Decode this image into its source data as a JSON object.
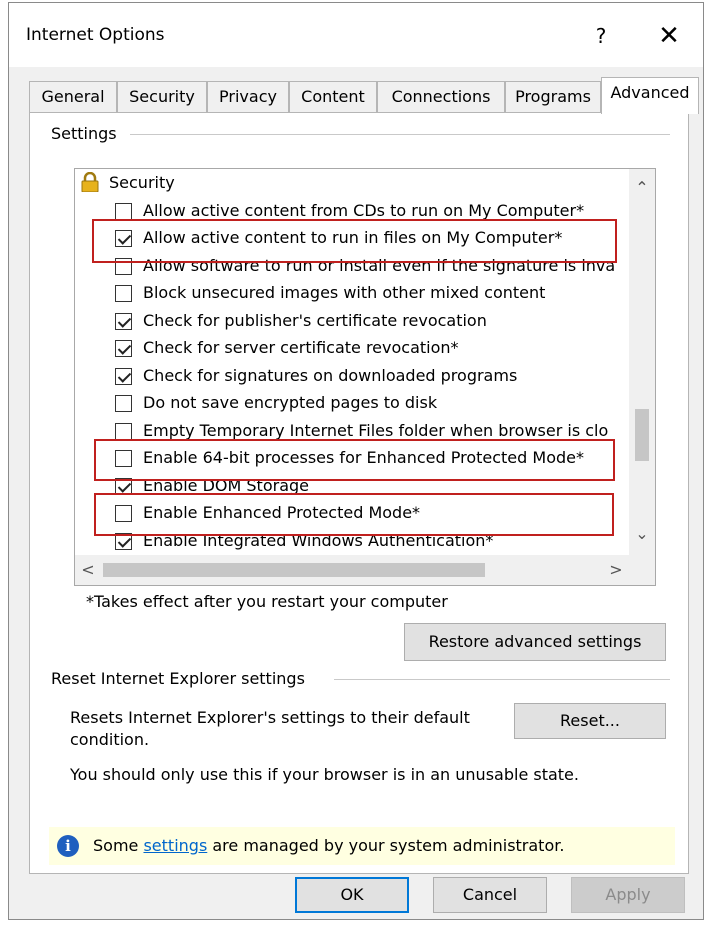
{
  "window": {
    "title": "Internet Options",
    "help_glyph": "?",
    "close_glyph": "✕"
  },
  "tabs": [
    "General",
    "Security",
    "Privacy",
    "Content",
    "Connections",
    "Programs",
    "Advanced"
  ],
  "active_tab": "Advanced",
  "settings": {
    "group_label": "Settings",
    "category": "Security",
    "items": [
      {
        "label": "Allow active content from CDs to run on My Computer*",
        "checked": false
      },
      {
        "label": "Allow active content to run in files on My Computer*",
        "checked": true
      },
      {
        "label": "Allow software to run or install even if the signature is inva",
        "checked": false
      },
      {
        "label": "Block unsecured images with other mixed content",
        "checked": false
      },
      {
        "label": "Check for publisher's certificate revocation",
        "checked": true
      },
      {
        "label": "Check for server certificate revocation*",
        "checked": true
      },
      {
        "label": "Check for signatures on downloaded programs",
        "checked": true
      },
      {
        "label": "Do not save encrypted pages to disk",
        "checked": false
      },
      {
        "label": "Empty Temporary Internet Files folder when browser is clo",
        "checked": false
      },
      {
        "label": "Enable 64-bit processes for Enhanced Protected Mode*",
        "checked": false
      },
      {
        "label": "Enable DOM Storage",
        "checked": true
      },
      {
        "label": "Enable Enhanced Protected Mode*",
        "checked": false
      },
      {
        "label": "Enable Integrated Windows Authentication*",
        "checked": true
      }
    ],
    "highlighted_items": [
      "Allow active content to run in files on My Computer*",
      "Enable 64-bit processes for Enhanced Protected Mode*",
      "Enable Enhanced Protected Mode*"
    ],
    "footnote": "*Takes effect after you restart your computer",
    "restore_button": "Restore advanced settings",
    "scroll_arrows": {
      "up": "⌃",
      "down": "⌄",
      "left": "<",
      "right": ">"
    }
  },
  "reset": {
    "group_label": "Reset Internet Explorer settings",
    "description": "Resets Internet Explorer's settings to their default condition.",
    "button": "Reset...",
    "warning": "You should only use this if your browser is in an unusable state."
  },
  "info_bar": {
    "prefix": "Some ",
    "link": "settings",
    "suffix": " are managed by your system administrator.",
    "icon": "info-icon"
  },
  "buttons": {
    "ok": "OK",
    "cancel": "Cancel",
    "apply": "Apply"
  },
  "colors": {
    "highlight_box": "#c0201e",
    "default_button_border": "#0078d7",
    "info_bar_bg": "#ffffe1",
    "link": "#0066cc"
  }
}
